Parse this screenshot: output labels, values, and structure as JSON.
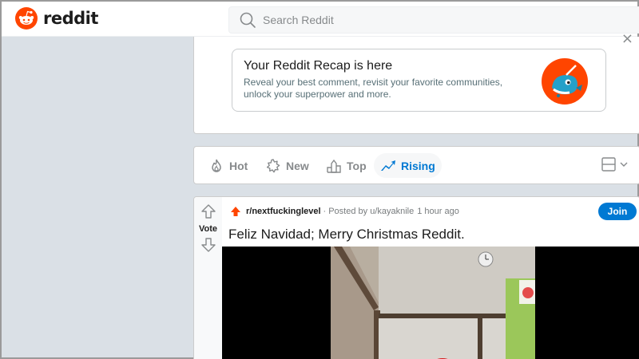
{
  "header": {
    "logo_text": "reddit",
    "search_placeholder": "Search Reddit"
  },
  "recap": {
    "close_glyph": "×",
    "title": "Your Reddit Recap is here",
    "description": "Reveal your best comment, revisit your favorite communities, unlock your superpower and more."
  },
  "sort": {
    "items": [
      {
        "label": "Hot",
        "icon": "flame-icon"
      },
      {
        "label": "New",
        "icon": "sparkle-burst-icon"
      },
      {
        "label": "Top",
        "icon": "podium-icon"
      },
      {
        "label": "Rising",
        "icon": "trending-up-icon"
      }
    ],
    "active": "Rising"
  },
  "post": {
    "vote_label": "Vote",
    "subreddit": "r/nextfuckinglevel",
    "separator": "·",
    "posted_by": "Posted by u/kayaknile",
    "time": "1 hour ago",
    "join_label": "Join",
    "title": "Feliz Navidad; Merry Christmas Reddit."
  },
  "colors": {
    "brand": "#ff4500",
    "accent": "#0079d3",
    "background": "#dae0e6"
  }
}
